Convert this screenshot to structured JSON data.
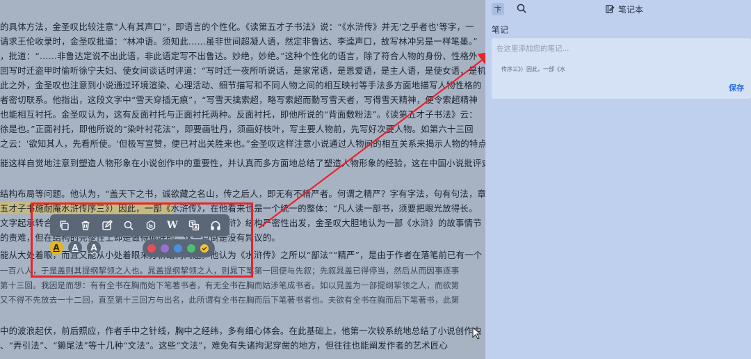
{
  "reader": {
    "lines": [
      {
        "text": "的具体方法，金圣叹比较注意“人有其声口”，即语言的个性化。《读第五才子书法》说：“《水浒传》并无'之乎者也'等字，一",
        "style": "normal"
      },
      {
        "text": "请求王伦收录时，金圣叹批道：“林冲语。须知此……虽非世间超凝人语，然定非鲁达、李逵声口，故写林冲另是一样笔墨。”",
        "style": "normal"
      },
      {
        "text": "，批道：“……非鲁达定说不出此语，非此语定写不出鲁达。妙绝，妙绝。”这种个性化的语言，除了符合人物的身份、性格外",
        "style": "normal"
      },
      {
        "text": "回写时迁盗甲时偷听徐宁夫妇、使女间谈话时评道：“写时迁一夜所听说话，是家常语，是恩爱语，是主人语，是使女语，是机",
        "style": "normal"
      },
      {
        "text": "此之外，金圣叹也注意到小说通过环境渲染、心理活动、细节描写和不同人物之间的相互映衬等手法多方面地描写人物性格的",
        "style": "normal"
      },
      {
        "text": "者密切联系。他指出，这段文字中“雪天穿插无痕”，“写雪天擒索超，略写索超而勤写雪天者，写得雪天精神，便令索超精神",
        "style": "normal"
      },
      {
        "text": "也能相互衬托。金圣叹认为，这有反面衬托与正面衬托两种。反面衬托，即他所说的“背面敷粉法”。《读第五才子书法》云：",
        "style": "normal"
      },
      {
        "text": "徐是也。”正面衬托，即他所说的“染叶衬花法”，即要画牡丹，须画好枝叶，写主要人物前，先写好次要人物。如第六十三回",
        "style": "normal"
      },
      {
        "text": "之云：'欲知其人，先看所使。'但极写宣赞，便已衬出关胜来也。”金圣叹这样注意小说通过人物间的相互关系来揭示人物的特点",
        "style": "normal"
      },
      {
        "text": "能这样自觉地注意到塑造人物形象在小说创作中的重要性，并认真而多方面地总结了塑造人物形象的经验，这在中国小说批评史",
        "style": "normal"
      },
      {
        "text": "结构布局等问题。他认为，“盖天下之书，诚欲藏之名山，传之后人，即无有不精严者。何谓之精严？字有字法，句有句法，章",
        "style": "normal"
      },
      {
        "text": "五才子书施耐庵水浒传序三》）因此，一部《水浒传》，在他看来也是一个统一的整体：“凡人读一部书，须要把眼光放得长。",
        "style": "highlight"
      },
      {
        "text": "文字起承转合之法，若是拖长看去，却都不见。”正是从《水浒》结构严密性出发，金圣叹大胆地认为一部《水浒》的故事情节",
        "style": "normal"
      },
      {
        "text": "的责难，但在结构的完整性上却是做得很好的，这一点倒是没有异议的。",
        "style": "normal"
      },
      {
        "text": "能从大处着眼，而且又能从小处着眼来分析结构问题。他认为《水浒传》之所以“部法”“精严”，是由于作者在落笔前已有一个",
        "style": "normal"
      },
      {
        "text": "一百八人，于是盖则其提纲挈领之人也。晁盖提纲挈领之人，则晁下笔第一回便与先叙；先叙晁盖已得停当，然后从而因事逐事",
        "style": "quote"
      },
      {
        "text": "第十三回。我因是而想：有有全书在胸而始下笔著书者，有无全书在胸而姑涉笔成书者。如以晁盖为一部提纲挈领之人，而欲第",
        "style": "quote"
      },
      {
        "text": "又不得不先放去一十二回，直至第十三回方与出名，此所谓有全书在胸而后下笔著书者也。夫欲有全书在胸而后下笔著书，此第",
        "style": "quote"
      },
      {
        "text": "中的波浪起伏，前后照应，作者手中之针线，胸中之经纬，多有细心体会。在此基础上，他第一次较系统地总结了小说创作中",
        "style": "normal"
      },
      {
        "text": "、“弄引法”、“獭尾法”等十几种“文法”。这些“文法”，难免有失诸拘泥穿凿的地方，但往往也能阐发作者的艺术匠心",
        "style": "normal"
      }
    ]
  },
  "toolbar": {
    "tools": [
      "copy-icon",
      "trash-icon",
      "edit-icon",
      "search-icon",
      "baidu-icon",
      "wikipedia-icon",
      "translate-icon",
      "headphones-icon"
    ],
    "wiki_glyph": "W",
    "text_styles": [
      "A",
      "A",
      "A"
    ],
    "colors": [
      "#e2515a",
      "#9a6fd3",
      "#4a8fe0",
      "#4cbf74",
      "#f2c530"
    ]
  },
  "panel": {
    "pin_glyph": "卞",
    "title": "笔记本",
    "section_label": "笔记",
    "note_placeholder": "在这里添加您的笔记...",
    "quote_snippet": "传序三》）因此，一部《水",
    "save_label": "保存"
  }
}
